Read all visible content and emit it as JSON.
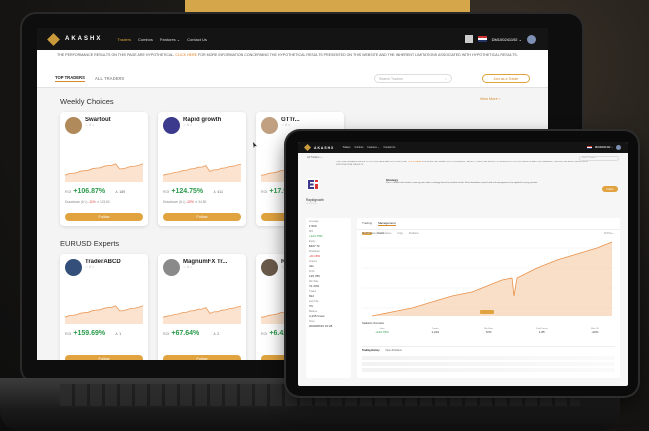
{
  "brand": "AKASHX",
  "nav": {
    "links": [
      "Traders",
      "Combos",
      "Features ⌄",
      "Contact Us"
    ],
    "account": "DM100241192 ⌄"
  },
  "notice": {
    "before": "THE PERFORMANCE RESULTS ON THIS PAGE ARE HYPOTHETICAL.",
    "link": "CLICK HERE",
    "after": "FOR MORE INFORMATION CONCERNING THE HYPOTHETICAL RESULTS PRESENTED ON THIS WEBSITE AND THE INHERENT LIMITATIONS ASSOCIATED WITH HYPOTHETICAL RESULTS."
  },
  "tabs": {
    "top": "TOP TRADERS",
    "all": "ALL TRADERS",
    "search_placeholder": "Search Traders",
    "join": "Join as a Trader"
  },
  "sections": {
    "weekly": "Weekly Choices",
    "eurusd": "EURUSD Experts",
    "view_more": "View More  ›"
  },
  "weekly_cards": [
    {
      "name": "Swartout",
      "roi": "+106.87%",
      "copiers": "189",
      "dd": "-11%",
      "extra": "115.60",
      "color": "#b08a5a"
    },
    {
      "name": "Rapid growth",
      "roi": "+124.75%",
      "copiers": "411",
      "dd": "-20%",
      "extra": "34.80",
      "color": "#3c3a8c"
    },
    {
      "name": "GTTr...",
      "roi": "+17.98%",
      "copiers": "",
      "dd": "",
      "extra": "",
      "color": "#c0a080"
    }
  ],
  "eurusd_cards": [
    {
      "name": "TraderABCD",
      "roi": "+159.69%",
      "copiers": "1",
      "color": "#34507a"
    },
    {
      "name": "MagnumFX Tr...",
      "roi": "+67.64%",
      "copiers": "2",
      "color": "#8a8a8a"
    },
    {
      "name": "Ro...",
      "roi": "+6.42%",
      "copiers": "",
      "color": "#6a5a4a"
    }
  ],
  "labels": {
    "roi": "ROI",
    "drawdown": "Drawdown (6 L)",
    "follow": "Follow"
  },
  "tablet": {
    "crumb": "All Traders  ›  ...",
    "search": "Search Traders",
    "trader_name": "Rapidgrowth",
    "bio_title": "Strategy",
    "bio": "We're a trader who trades currency pairs with a strategy based on market trends. Strict drawdown control and risk management are applied to every position.",
    "follow": "Follow",
    "main_tabs": [
      "Trading",
      "Management"
    ],
    "sub_tabs": [
      "Profit",
      "Performance",
      "Copy",
      "Positions"
    ],
    "sub_right": "All Time ⌄",
    "chart_label": "Performance Growth",
    "stats_title": "Statistics  Overview",
    "stats": [
      {
        "label": "Gain",
        "value": "+124.75%"
      },
      {
        "label": "Trades",
        "value": "1,210"
      },
      {
        "label": "Win Rate",
        "value": "72%"
      },
      {
        "label": "Profit Factor",
        "value": "1.85"
      },
      {
        "label": "Max DD",
        "value": "-20%"
      }
    ],
    "history_tabs": [
      "Trading History",
      "Open Positions"
    ],
    "side": [
      {
        "label": "Leverage",
        "value": "1:500",
        "tone": ""
      },
      {
        "label": "ROI",
        "value": "+124.75%",
        "tone": "green"
      },
      {
        "label": "Equity",
        "value": "$467.7k",
        "tone": ""
      },
      {
        "label": "Drawdown",
        "value": "-20.18%",
        "tone": "red"
      },
      {
        "label": "Copiers",
        "value": "411",
        "tone": ""
      },
      {
        "label": "Profit",
        "value": "126,786",
        "tone": ""
      },
      {
        "label": "Win Rate",
        "value": "72.43%",
        "tone": ""
      },
      {
        "label": "Trades",
        "value": "812",
        "tone": ""
      },
      {
        "label": "Avg Hold",
        "value": "7hr",
        "tone": ""
      },
      {
        "label": "Balance",
        "value": "3,435 times",
        "tone": ""
      },
      {
        "label": "Since",
        "value": "2020/08/16 10:28",
        "tone": ""
      }
    ]
  },
  "colors": {
    "accent": "#e0a340",
    "gain": "#2b9a4a",
    "loss": "#d33333"
  }
}
